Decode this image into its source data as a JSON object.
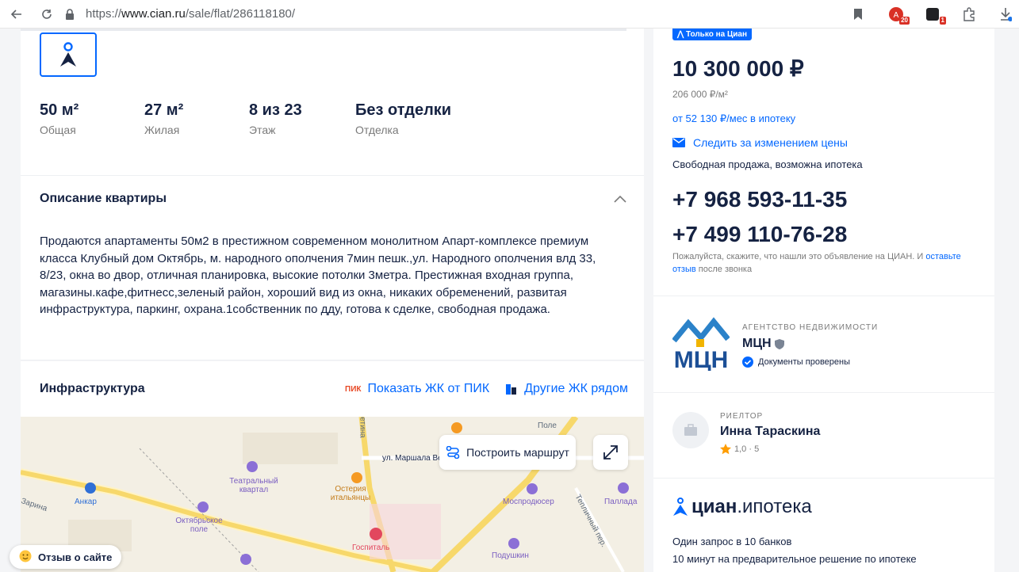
{
  "browser": {
    "url_protocol": "https://",
    "url_host": "www.cian.ru",
    "url_path": "/sale/flat/286118180/",
    "ext_badge_1": "20",
    "ext_badge_2": "1"
  },
  "summary": {
    "stats": [
      {
        "value": "50 м²",
        "label": "Общая"
      },
      {
        "value": "27 м²",
        "label": "Жилая"
      },
      {
        "value": "8 из 23",
        "label": "Этаж"
      },
      {
        "value": "Без отделки",
        "label": "Отделка"
      }
    ]
  },
  "description": {
    "title": "Описание квартиры",
    "text": "Продаются апартаменты 50м2  в престижном современном монолитном Апарт-комплексе премиум класса Клубный дом Октябрь, м. народного ополчения 7мин пешк.,ул. Народного ополчения влд 33, 8/23, окна во двор, отличная планировка, высокие потолки 3метра. Престижная входная группа,  магазины.кафе,фитнесс,зеленый район, хороший вид из окна, никаких обременений, развитая инфраструктура, паркинг, охрана.1собственник по дду, готова к сделке, свободная продажа."
  },
  "infrastructure": {
    "title": "Инфраструктура",
    "pik_logo": "ПИК",
    "show_pik": "Показать ЖК от ПИК",
    "other_nearby": "Другие ЖК рядом"
  },
  "map": {
    "route_button": "Построить маршрут",
    "labels": {
      "street": "ул. Маршала Ве",
      "field": "Поле",
      "theatre": "Театральный квартал",
      "osteria": "Остерия итальянцы",
      "mosprod": "Моспродюсер",
      "pallada": "Паллада",
      "ankar": "Анкар",
      "oktyabr": "Октябрьское поле",
      "hospital": "Госпиталь",
      "podushkin": "Подушкин",
      "teplichny": "Тепличный пер.",
      "zarina": "Зарина",
      "etina": "етина"
    }
  },
  "feedback": {
    "label": "Отзыв о сайте"
  },
  "offer": {
    "badge": "Только на Циан",
    "price": "10 300 000 ₽",
    "price_per_m2": "206 000 ₽/м²",
    "mortgage": "от 52 130 ₽/мес в ипотеку",
    "watch_price": "Следить за изменением цены",
    "sale_type": "Свободная продажа, возможна ипотека",
    "phone1": "+7 968 593-11-35",
    "phone2": "+7 499 110-76-28",
    "note_before": "Пожалуйста, скажите, что нашли это объявление на ЦИАН. И ",
    "note_link": "оставьте отзыв",
    "note_after": " после звонка"
  },
  "agency": {
    "type": "АГЕНТСТВО НЕДВИЖИМОСТИ",
    "name": "МЦН",
    "logo_text": "МЦН",
    "verified": "Документы проверены"
  },
  "realtor": {
    "role": "РИЕЛТОР",
    "name": "Инна Тараскина",
    "rating": "1,0 · 5"
  },
  "ipoteka": {
    "logo_brand": "циан",
    "logo_suffix": ".ипотека",
    "line1": "Один запрос в 10 банков",
    "line2": "10 минут на предварительное решение по ипотеке"
  },
  "colors": {
    "accent": "#0468ff",
    "text": "#152242",
    "pik": "#e84a27",
    "star": "#ff9d00"
  }
}
